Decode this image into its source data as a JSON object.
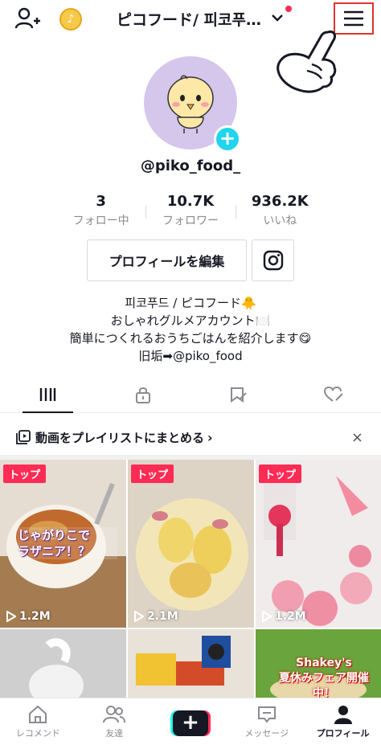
{
  "header": {
    "title": "ピコフード/ 피코푸…",
    "coin_icon": "music-note-coin-icon",
    "notification_color": "#fe2c55",
    "menu_highlight_color": "#e0332f"
  },
  "profile": {
    "handle": "@piko_food_",
    "avatar_bg": "#d5c6ec",
    "add_badge_color": "#20d5ec"
  },
  "stats": [
    {
      "value": "3",
      "label": "フォロー中"
    },
    {
      "value": "10.7K",
      "label": "フォロワー"
    },
    {
      "value": "936.2K",
      "label": "いいね"
    }
  ],
  "actions": {
    "edit_profile": "プロフィールを編集",
    "instagram_icon": "instagram-icon"
  },
  "bio": [
    "피코푸드 / ピコフード🐥",
    "おしゃれグルメアカウント🍽️",
    "簡単につくれるおうちごはんを紹介します😋",
    "旧垢➡@piko_food"
  ],
  "tabs": [
    {
      "icon": "videos-grid-icon",
      "active": true
    },
    {
      "icon": "lock-icon",
      "active": false
    },
    {
      "icon": "bookmark-icon",
      "active": false
    },
    {
      "icon": "liked-heart-icon",
      "active": false
    }
  ],
  "playlist_banner": {
    "text": "動画をプレイリストにまとめる",
    "chevron": "›",
    "close": "×"
  },
  "videos": [
    {
      "badge": "トップ",
      "views": "1.2M",
      "overlay": "じゃがりこで\nラザニア！？"
    },
    {
      "badge": "トップ",
      "views": "2.1M",
      "overlay": ""
    },
    {
      "badge": "トップ",
      "views": "1.2M",
      "overlay": ""
    },
    {
      "badge": "",
      "views": "",
      "overlay": ""
    },
    {
      "badge": "",
      "views": "",
      "overlay": ""
    },
    {
      "badge": "",
      "views": "",
      "overlay": "Shakey's\n夏休みフェア開催中！"
    }
  ],
  "bottom_nav": [
    {
      "label": "レコメンド",
      "icon": "home-icon",
      "active": false
    },
    {
      "label": "友達",
      "icon": "friends-icon",
      "active": false
    },
    {
      "label": "",
      "icon": "create-plus-icon",
      "active": false
    },
    {
      "label": "メッセージ",
      "icon": "inbox-icon",
      "active": false
    },
    {
      "label": "プロフィール",
      "icon": "profile-icon",
      "active": true
    }
  ],
  "accent": "#fe2c55"
}
